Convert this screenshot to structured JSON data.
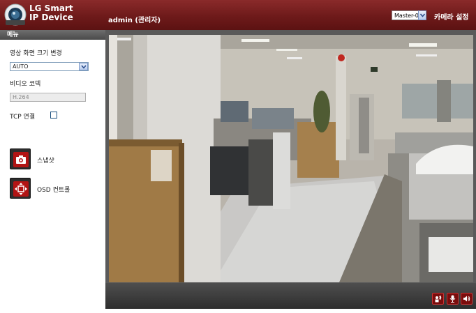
{
  "header": {
    "brand_line1": "LG Smart",
    "brand_line2": "IP Device",
    "user": "admin (관리자)",
    "camera_select": "Master-0",
    "camera_settings": "카메라 설정",
    "logo_icon": "lg-camera-logo-icon"
  },
  "sidebar": {
    "menu_title": "메뉴",
    "resolution_label": "영상 화면 크기 변경",
    "resolution_value": "AUTO",
    "codec_label": "비디오 코덱",
    "codec_value": "H.264",
    "tcp_label": "TCP 연결",
    "tcp_checked": false,
    "snapshot_label": "스냅샷",
    "snapshot_icon": "camera-icon",
    "osd_label": "OSD 컨트롤",
    "osd_icon": "move-arrows-icon"
  },
  "controls": {
    "buttons": [
      {
        "icon": "speaker-wave-icon"
      },
      {
        "icon": "microphone-icon"
      },
      {
        "icon": "volume-icon"
      }
    ]
  },
  "colors": {
    "header": "#6e1a1a",
    "menu_bar": "#555555",
    "button_red": "#7b0d0d",
    "control_bar": "#3a3a3a"
  }
}
